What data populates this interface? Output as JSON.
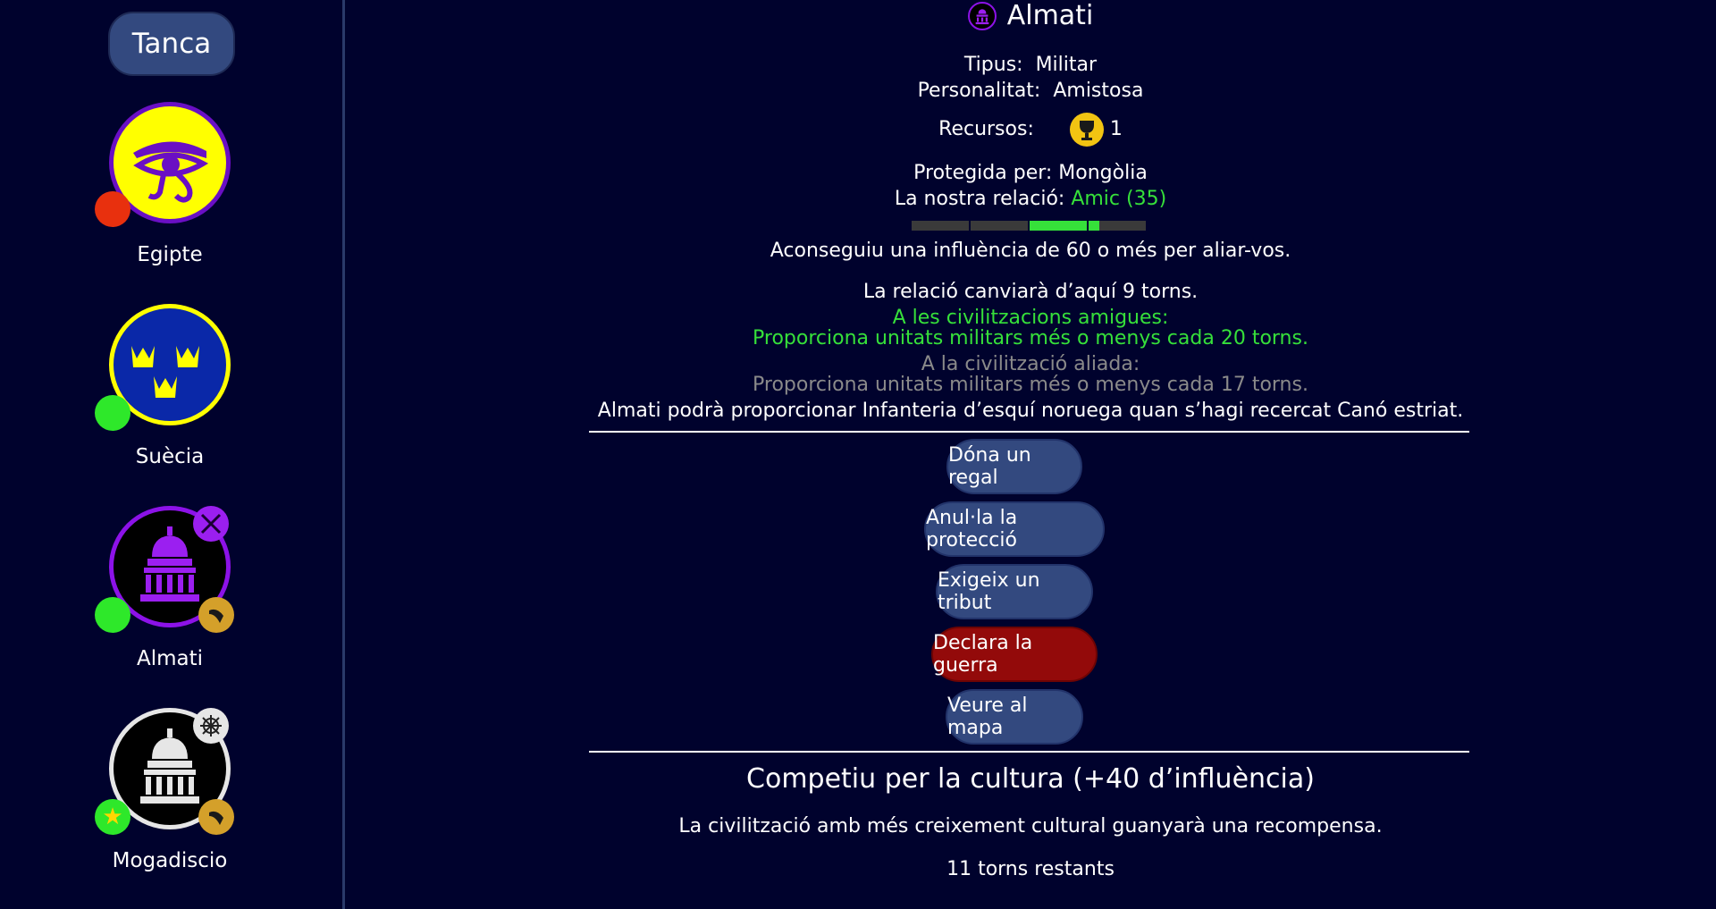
{
  "sidebar": {
    "close_label": "Tanca",
    "civs": [
      {
        "name": "Egipte",
        "icon": "eye-of-horus-icon",
        "status": "red"
      },
      {
        "name": "Suècia",
        "icon": "three-crowns-icon",
        "status": "green"
      },
      {
        "name": "Almati",
        "icon": "capitol-icon",
        "status": "green",
        "badges": [
          "crossed-swords-icon",
          "horn-icon"
        ]
      },
      {
        "name": "Mogadiscio",
        "icon": "capitol-icon",
        "status": "green-star",
        "badges": [
          "ship-wheel-icon",
          "horn-icon"
        ]
      }
    ]
  },
  "detail": {
    "title": "Almati",
    "type_label": "Tipus:",
    "type_value": "Militar",
    "personality_label": "Personalitat:",
    "personality_value": "Amistosa",
    "resources_label": "Recursos:",
    "resource_count": "1",
    "protected_by": "Protegida per: Mongòlia",
    "relation_label": "La nostra relació:",
    "relation_value": "Amic (35)",
    "influence_note": "Aconseguiu una influència de 60 o més per aliar-vos.",
    "change_note": "La relació canviarà d’aquí 9 torns.",
    "friends_heading": "A les civilitzacions amigues:",
    "friends_bonus": "Proporciona unitats militars més o menys cada 20 torns.",
    "ally_heading": "A la civilització aliada:",
    "ally_bonus": "Proporciona unitats militars més o menys cada 17 torns.",
    "unit_note": "Almati podrà proporcionar Infanteria d’esquí noruega quan s’hagi recercat Canó estriat."
  },
  "actions": {
    "gift": "Dóna un regal",
    "revoke": "Anul·la la protecció",
    "tribute": "Exigeix un tribut",
    "war": "Declara la guerra",
    "map": "Veure al mapa"
  },
  "quest": {
    "title": "Competiu per la cultura (+40 d’influència)",
    "description": "La civilització amb més creixement cultural guanyarà una recompensa.",
    "turns_left": "11 torns restants"
  },
  "colors": {
    "background": "#00022d",
    "button": "#33497f",
    "war_button": "#930a0a",
    "friend_green": "#36e03a",
    "egypt_fill": "#ffff00",
    "egypt_border": "#6a0fc4",
    "sweden_fill": "#0a28a8",
    "sweden_border": "#ffff00",
    "almati_border": "#8c12e8"
  },
  "relation_bar": {
    "value": 35
  }
}
